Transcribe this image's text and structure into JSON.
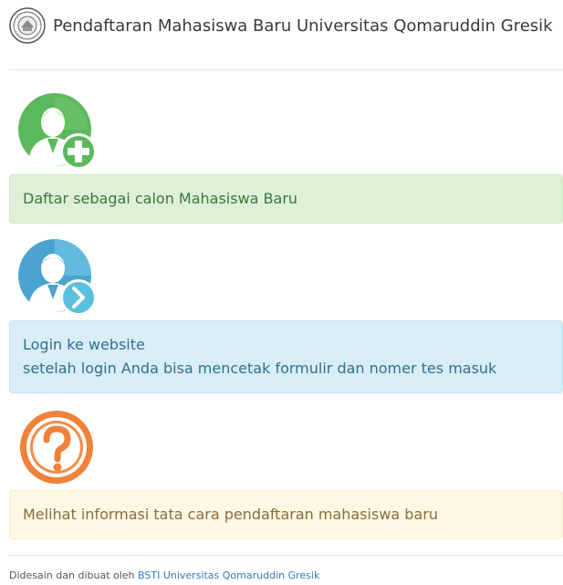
{
  "header": {
    "title": "Pendaftaran Mahasiswa Baru Universitas Qomaruddin Gresik",
    "logo_icon": "university-seal-logo"
  },
  "cards": [
    {
      "icon": "user-add-icon",
      "icon_color": "#5cb85c",
      "lines": [
        "Daftar sebagai calon Mahasiswa Baru"
      ],
      "variant": "success"
    },
    {
      "icon": "user-login-icon",
      "icon_color": "#5bc0de",
      "lines": [
        "Login ke website",
        "setelah login Anda bisa mencetak formulir dan nomer tes masuk"
      ],
      "variant": "info"
    },
    {
      "icon": "question-mark-icon",
      "icon_color": "#f0813a",
      "lines": [
        "Melihat informasi tata cara pendaftaran mahasiswa baru"
      ],
      "variant": "warning"
    }
  ],
  "footer": {
    "prefix": "Didesain dan dibuat oleh ",
    "link_text": "BSTI Universitas Qomaruddin Gresik"
  },
  "colors": {
    "success_bg": "#dff0d8",
    "info_bg": "#d9edf7",
    "warning_bg": "#fcf8e3",
    "link": "#337ab7"
  }
}
